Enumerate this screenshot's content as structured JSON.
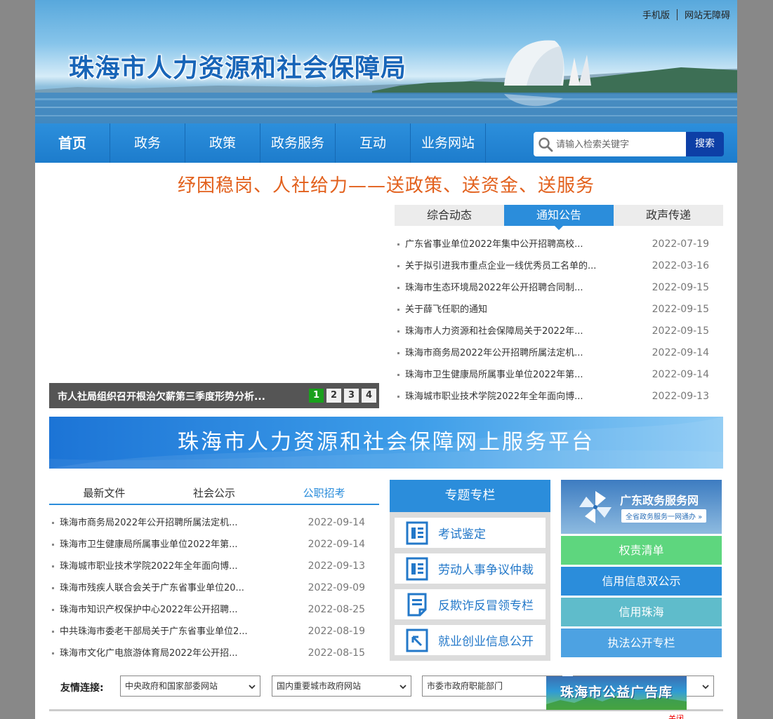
{
  "header": {
    "site_title": "珠海市人力资源和社会保障局",
    "top_links": [
      "手机版",
      "网站无障碍"
    ]
  },
  "nav": {
    "items": [
      "首页",
      "政务",
      "政策",
      "政务服务",
      "互动",
      "业务网站"
    ],
    "search_placeholder": "请输入检索关键字",
    "search_button": "搜索"
  },
  "slogan": "纾困稳岗、人社给力——送政策、送资金、送服务",
  "slider": {
    "caption": "市人社局组织召开根治欠薪第三季度形势分析...",
    "pages": [
      "1",
      "2",
      "3",
      "4"
    ],
    "active_page": "1"
  },
  "news": {
    "tabs": [
      "综合动态",
      "通知公告",
      "政声传递"
    ],
    "active_tab": "通知公告",
    "items": [
      {
        "title": "广东省事业单位2022年集中公开招聘高校...",
        "date": "2022-07-19"
      },
      {
        "title": "关于拟引进我市重点企业一线优秀员工名单的...",
        "date": "2022-03-16"
      },
      {
        "title": "珠海市生态环境局2022年公开招聘合同制...",
        "date": "2022-09-15"
      },
      {
        "title": "关于薛飞任职的通知",
        "date": "2022-09-15"
      },
      {
        "title": "珠海市人力资源和社会保障局关于2022年...",
        "date": "2022-09-15"
      },
      {
        "title": "珠海市商务局2022年公开招聘所属法定机...",
        "date": "2022-09-14"
      },
      {
        "title": "珠海市卫生健康局所属事业单位2022年第...",
        "date": "2022-09-14"
      },
      {
        "title": "珠海城市职业技术学院2022年全年面向博...",
        "date": "2022-09-13"
      }
    ]
  },
  "platform_banner": "珠海市人力资源和社会保障网上服务平台",
  "files": {
    "tabs": [
      "最新文件",
      "社会公示",
      "公职招考"
    ],
    "active_tab": "公职招考",
    "items": [
      {
        "title": "珠海市商务局2022年公开招聘所属法定机...",
        "date": "2022-09-14"
      },
      {
        "title": "珠海市卫生健康局所属事业单位2022年第...",
        "date": "2022-09-14"
      },
      {
        "title": "珠海城市职业技术学院2022年全年面向博...",
        "date": "2022-09-13"
      },
      {
        "title": "珠海市残疾人联合会关于广东省事业单位20...",
        "date": "2022-09-09"
      },
      {
        "title": "珠海市知识产权保护中心2022年公开招聘...",
        "date": "2022-08-25"
      },
      {
        "title": "中共珠海市委老干部局关于广东省事业单位2...",
        "date": "2022-08-19"
      },
      {
        "title": "珠海市文化广电旅游体育局2022年公开招...",
        "date": "2022-08-15"
      }
    ]
  },
  "special": {
    "title": "专题专栏",
    "items": [
      {
        "label": "考试鉴定",
        "icon": "exam-doc-icon"
      },
      {
        "label": "劳动人事争议仲裁",
        "icon": "arbitration-doc-icon"
      },
      {
        "label": "反欺诈反冒领专栏",
        "icon": "anti-fraud-icon"
      },
      {
        "label": "就业创业信息公开",
        "icon": "arrow-box-icon"
      }
    ]
  },
  "right_links": {
    "gd_title": "广东政务服务网",
    "gd_sub": "全省政务服务一网通办 »",
    "items": [
      {
        "label": "权责清单",
        "color": "#5ed67e"
      },
      {
        "label": "信用信息双公示",
        "color": "#2b8ddb"
      },
      {
        "label": "信用珠海",
        "color": "#5fbccb"
      },
      {
        "label": "执法公开专栏",
        "color": "#4da2e2"
      }
    ]
  },
  "friend_links": {
    "label": "友情连接:",
    "selects": [
      "中央政府和国家部委网站",
      "国内重要城市政府网站",
      "市委市政府职能部门",
      ""
    ]
  },
  "ad": {
    "title": "珠海市公益广告库",
    "close": "关闭"
  },
  "colors": {
    "nav_blue": "#1d7ccc",
    "accent_blue": "#2b8ddb",
    "slogan_orange": "#e2601c",
    "search_button": "#0d3fa6"
  }
}
